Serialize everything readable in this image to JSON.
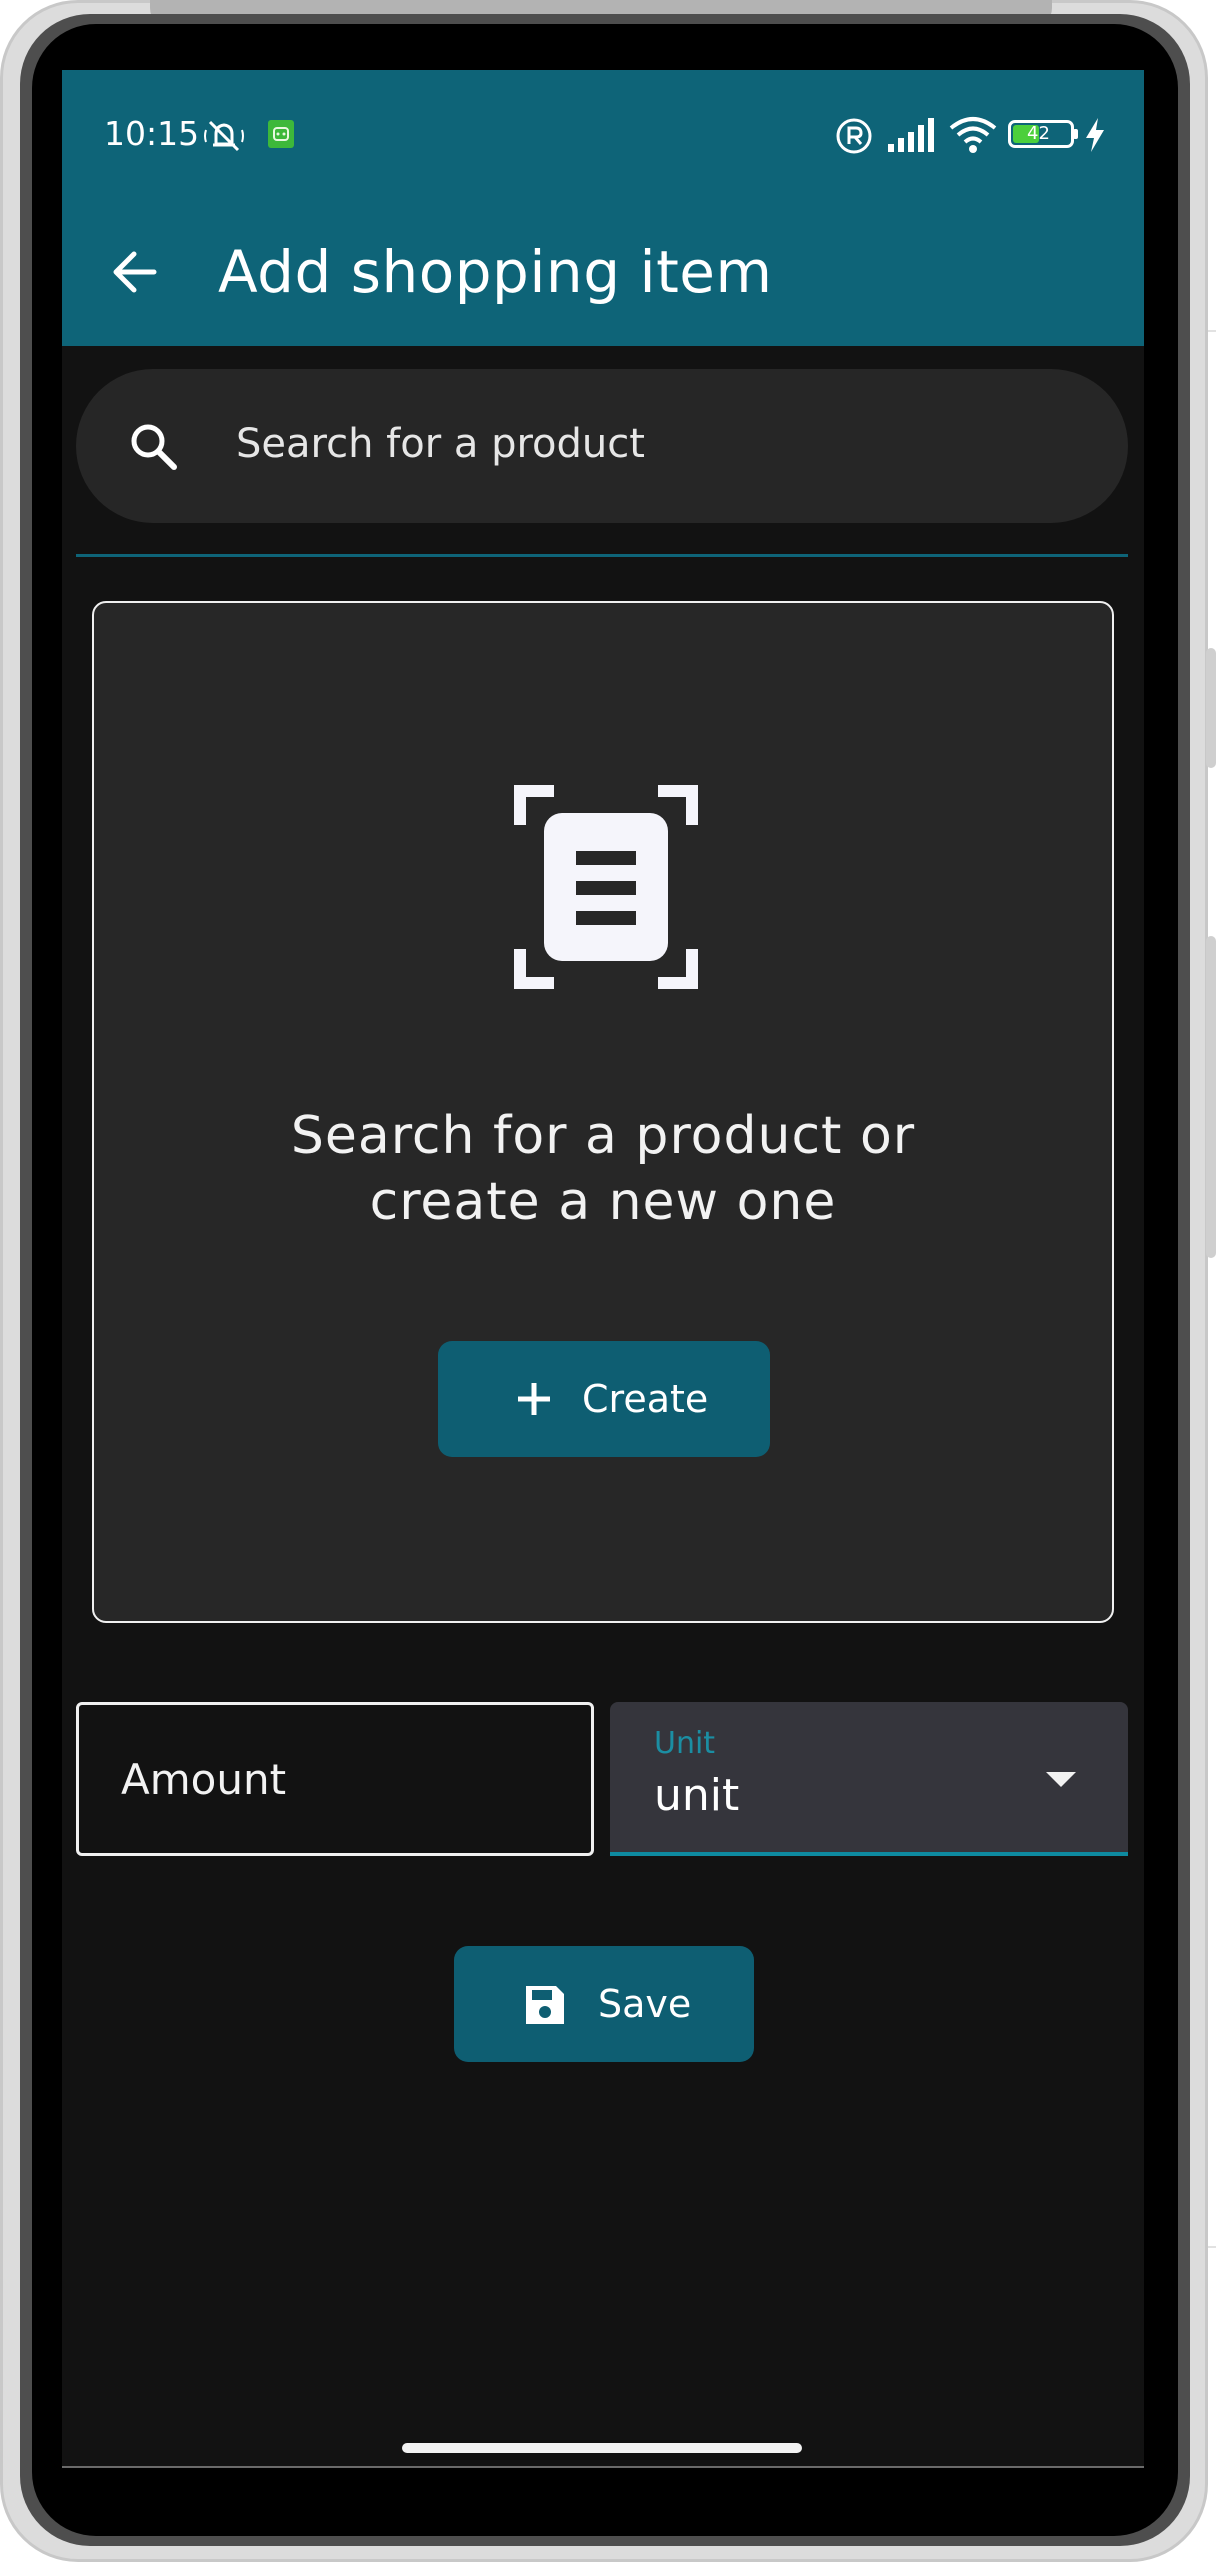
{
  "status_bar": {
    "time": "10:15",
    "battery_level": "42",
    "icons": [
      "mute-icon",
      "app-notification-icon",
      "registered-icon",
      "cell-signal-icon",
      "wifi-icon",
      "battery-icon",
      "charging-icon"
    ]
  },
  "app_bar": {
    "title": "Add shopping item",
    "back_icon": "arrow-back-icon",
    "color": "#0e6478"
  },
  "search": {
    "placeholder": "Search for a product",
    "icon": "search-icon"
  },
  "empty_state": {
    "icon": "barcode-scan-icon",
    "message_line1": "Search for a product or",
    "message_line2": "create a new one",
    "create_button": {
      "label": "Create",
      "icon": "plus-icon"
    }
  },
  "form": {
    "amount": {
      "placeholder": "Amount",
      "value": ""
    },
    "unit": {
      "label": "Unit",
      "value": "unit",
      "icon": "dropdown-arrow-icon"
    }
  },
  "save_button": {
    "label": "Save",
    "icon": "floppy-disk-icon",
    "color": "#0e5e72"
  },
  "accent_color": "#0e8aa0"
}
